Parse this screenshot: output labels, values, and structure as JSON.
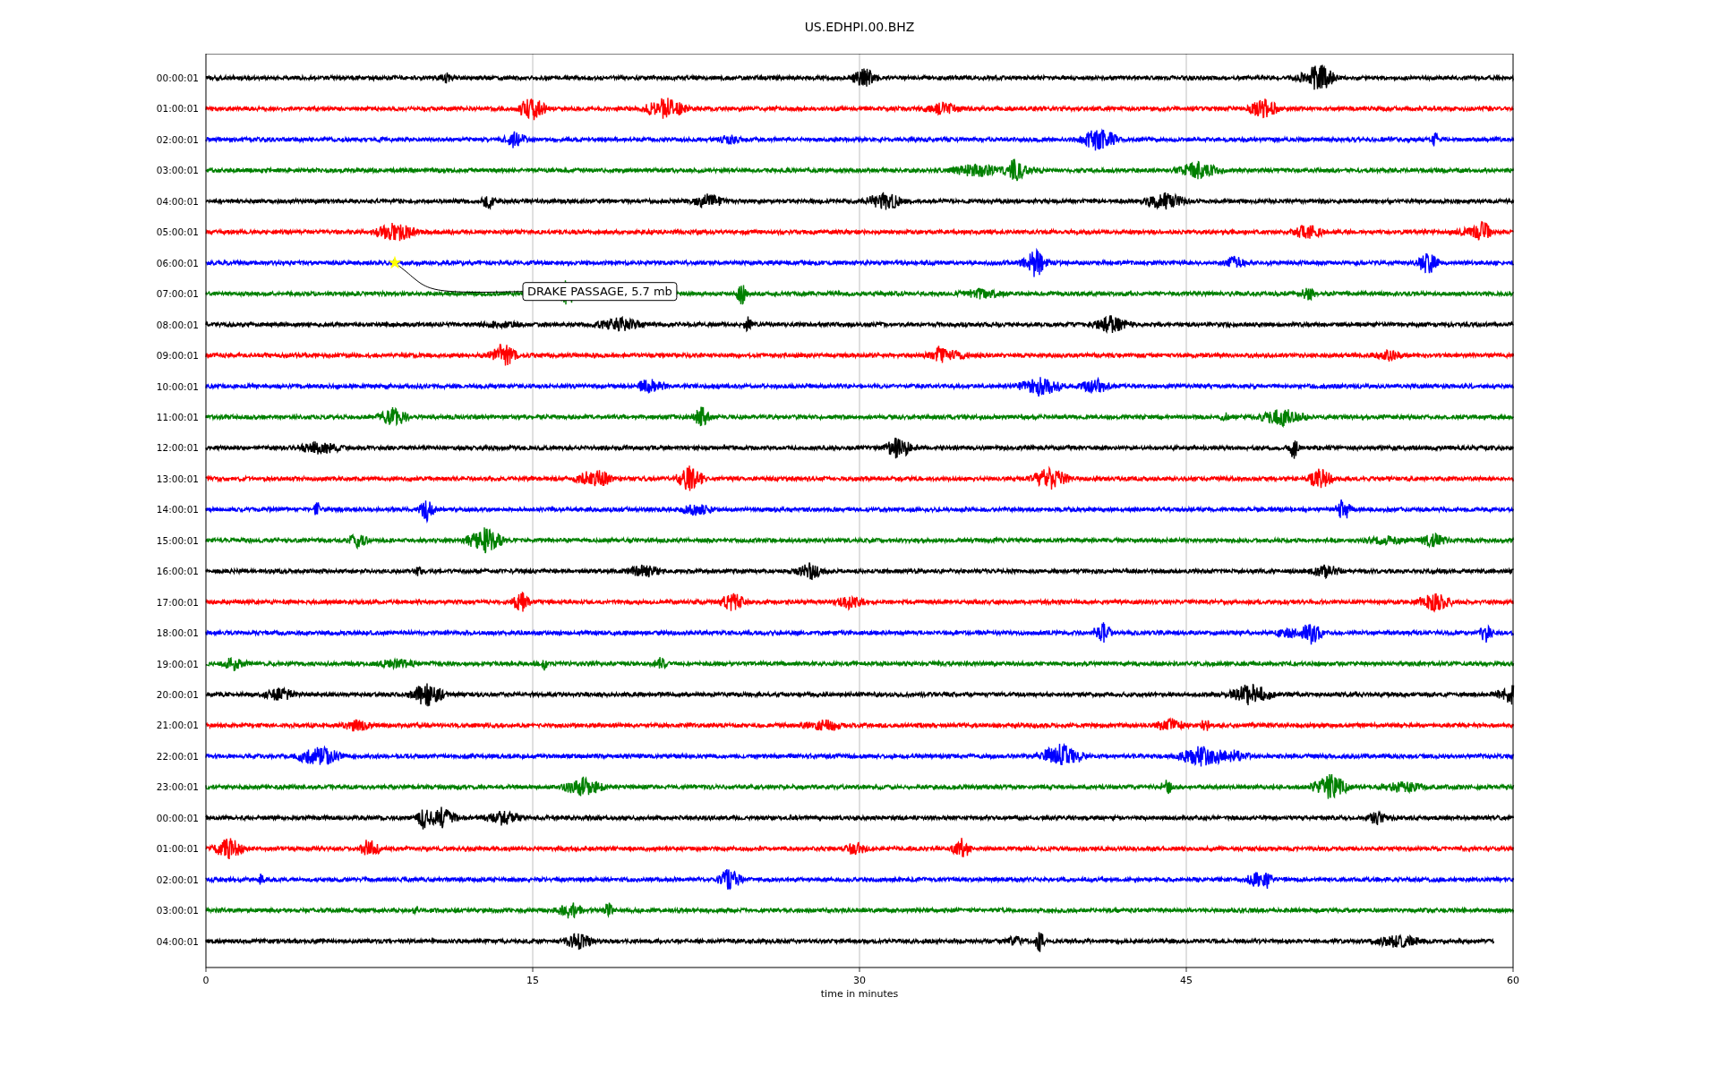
{
  "title": "US.EDHPI.00.BHZ",
  "traces": [
    {
      "label": "00:00:01",
      "color": "#000000"
    },
    {
      "label": "01:00:01",
      "color": "#ff0000"
    },
    {
      "label": "02:00:01",
      "color": "#0000ff"
    },
    {
      "label": "03:00:01",
      "color": "#008000"
    },
    {
      "label": "04:00:01",
      "color": "#000000"
    },
    {
      "label": "05:00:01",
      "color": "#ff0000"
    },
    {
      "label": "06:00:01",
      "color": "#0000ff",
      "annotation": "DRAKE PASSAGE, 5.7 mb"
    },
    {
      "label": "07:00:01",
      "color": "#008000"
    },
    {
      "label": "08:00:01",
      "color": "#000000"
    },
    {
      "label": "09:00:01",
      "color": "#ff0000"
    },
    {
      "label": "10:00:01",
      "color": "#0000ff"
    },
    {
      "label": "11:00:01",
      "color": "#008000"
    },
    {
      "label": "12:00:01",
      "color": "#000000"
    },
    {
      "label": "13:00:01",
      "color": "#ff0000"
    },
    {
      "label": "14:00:01",
      "color": "#0000ff"
    },
    {
      "label": "15:00:01",
      "color": "#008000"
    },
    {
      "label": "16:00:01",
      "color": "#000000"
    },
    {
      "label": "17:00:01",
      "color": "#ff0000"
    },
    {
      "label": "18:00:01",
      "color": "#0000ff"
    },
    {
      "label": "19:00:01",
      "color": "#008000"
    },
    {
      "label": "20:00:01",
      "color": "#000000"
    },
    {
      "label": "21:00:01",
      "color": "#ff0000"
    },
    {
      "label": "22:00:01",
      "color": "#0000ff"
    },
    {
      "label": "23:00:01",
      "color": "#008000"
    },
    {
      "label": "00:00:01",
      "color": "#000000"
    },
    {
      "label": "01:00:01",
      "color": "#ff0000"
    },
    {
      "label": "02:00:01",
      "color": "#0000ff"
    },
    {
      "label": "03:00:01",
      "color": "#008000"
    },
    {
      "label": "04:00:01",
      "color": "#000000"
    }
  ],
  "x_axis": {
    "label": "time in minutes",
    "ticks": [
      "0",
      "15",
      "30",
      "45",
      "60"
    ]
  }
}
